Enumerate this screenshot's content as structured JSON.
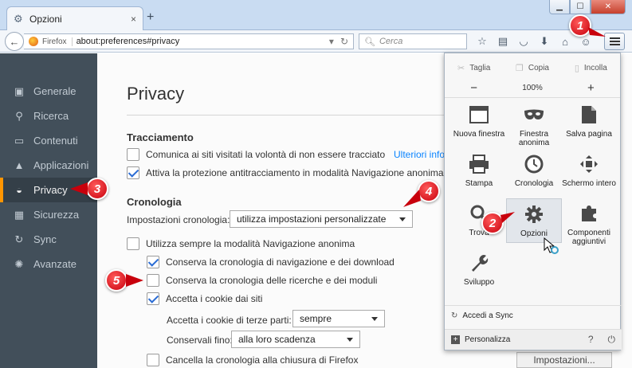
{
  "window": {
    "tab_title": "Opzioni",
    "new_tab": "+",
    "close_tab": "×"
  },
  "toolbar": {
    "brand": "Firefox",
    "url": "about:preferences#privacy",
    "search_placeholder": "Cerca"
  },
  "sidebar": {
    "items": [
      {
        "label": "Generale",
        "icon": "general-icon"
      },
      {
        "label": "Ricerca",
        "icon": "search-icon"
      },
      {
        "label": "Contenuti",
        "icon": "content-icon"
      },
      {
        "label": "Applicazioni",
        "icon": "applications-icon"
      },
      {
        "label": "Privacy",
        "icon": "privacy-mask-icon",
        "selected": true
      },
      {
        "label": "Sicurezza",
        "icon": "security-icon"
      },
      {
        "label": "Sync",
        "icon": "sync-icon"
      },
      {
        "label": "Avanzate",
        "icon": "advanced-icon"
      }
    ]
  },
  "main": {
    "title": "Privacy",
    "tracking": {
      "heading": "Tracciamento",
      "dnt_label": "Comunica ai siti visitati la volontà di non essere tracciato",
      "dnt_checked": false,
      "more_info": "Ulteriori info",
      "tp_label": "Attiva la protezione antitracciamento in modalità Navigazione anonima",
      "tp_checked": true
    },
    "history": {
      "heading": "Cronologia",
      "settings_label": "Impostazioni cronologia:",
      "settings_value": "utilizza impostazioni personalizzate",
      "always_private": "Utilizza sempre la modalità Navigazione anonima",
      "always_private_checked": false,
      "keep_browsing": "Conserva la cronologia di navigazione e dei download",
      "keep_browsing_checked": true,
      "keep_search": "Conserva la cronologia delle ricerche e dei moduli",
      "keep_search_checked": false,
      "accept_cookies": "Accetta i cookie dai siti",
      "accept_cookies_checked": true,
      "third_party_label": "Accetta i cookie di terze parti:",
      "third_party_value": "sempre",
      "keep_until_label": "Conservali fino:",
      "keep_until_value": "alla loro scadenza",
      "clear_on_close": "Cancella la cronologia alla chiusura di Firefox",
      "clear_on_close_checked": false,
      "settings_button": "Impostazioni..."
    }
  },
  "menu_panel": {
    "cut": "Taglia",
    "copy": "Copia",
    "paste": "Incolla",
    "zoom_out": "−",
    "zoom": "100%",
    "zoom_in": "+",
    "items": [
      {
        "label": "Nuova finestra",
        "icon": "new-window-icon"
      },
      {
        "label": "Finestra anonima",
        "icon": "private-window-mask-icon"
      },
      {
        "label": "Salva pagina",
        "icon": "save-page-icon"
      },
      {
        "label": "Stampa",
        "icon": "print-icon"
      },
      {
        "label": "Cronologia",
        "icon": "history-clock-icon"
      },
      {
        "label": "Schermo intero",
        "icon": "fullscreen-icon"
      },
      {
        "label": "Trova",
        "icon": "find-icon"
      },
      {
        "label": "Opzioni",
        "icon": "options-gear-icon",
        "hover": true
      },
      {
        "label": "Componenti aggiuntivi",
        "icon": "addons-puzzle-icon"
      },
      {
        "label": "Sviluppo",
        "icon": "developer-wrench-icon"
      }
    ],
    "sync": "Accedi a Sync",
    "customize": "Personalizza"
  },
  "callouts": [
    "1",
    "2",
    "3",
    "4",
    "5"
  ],
  "colors": {
    "sidebar_bg": "#424f5a",
    "sidebar_selected_accent": "#ff9500",
    "link": "#0a84ff",
    "checkbox_check": "#2b6cd4",
    "callout_red": "#c8000c"
  }
}
